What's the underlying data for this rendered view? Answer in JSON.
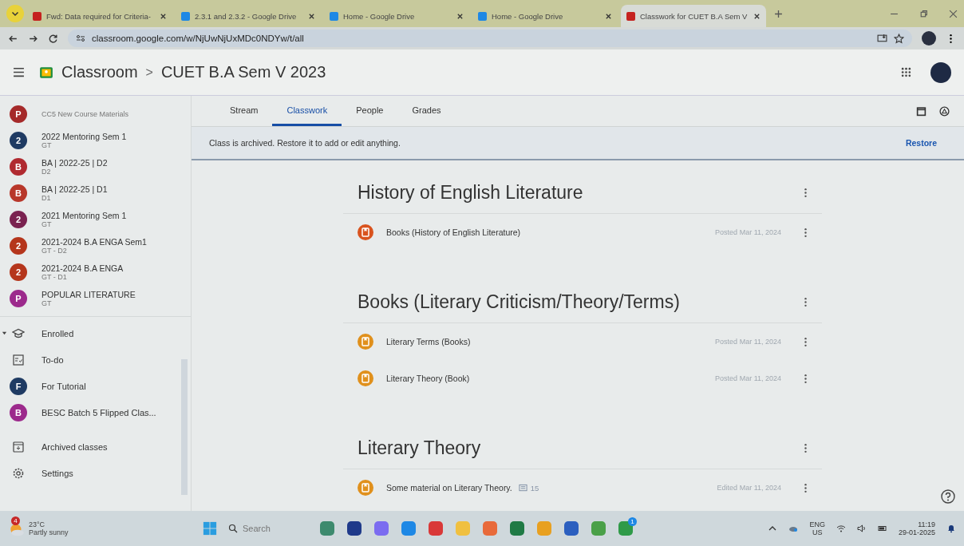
{
  "browser": {
    "tabs": [
      {
        "title": "Fwd: Data required for Criteria-",
        "selected": false
      },
      {
        "title": "2.3.1 and 2.3.2 - Google Drive",
        "selected": false
      },
      {
        "title": "Home - Google Drive",
        "selected": false
      },
      {
        "title": "Home - Google Drive",
        "selected": false
      },
      {
        "title": "Classwork for CUET B.A Sem V",
        "selected": true
      }
    ],
    "address": "classroom.google.com/w/NjUwNjUxMDc0NDYw/t/all"
  },
  "header": {
    "app": "Classroom",
    "separator": ">",
    "class_name": "CUET B.A Sem V 2023"
  },
  "sidebar": {
    "classes": [
      {
        "letter": "P",
        "sub": "CC5 New Course Materials",
        "color": "#a52a2a"
      },
      {
        "letter": "2",
        "name": "2022 Mentoring Sem 1",
        "sub": "GT",
        "color": "#1f3b63"
      },
      {
        "letter": "B",
        "name": "BA | 2022-25 | D2",
        "sub": "D2",
        "color": "#b02a30"
      },
      {
        "letter": "B",
        "name": "BA | 2022-25 | D1",
        "sub": "D1",
        "color": "#b8372a"
      },
      {
        "letter": "2",
        "name": "2021 Mentoring Sem 1",
        "sub": "GT",
        "color": "#7a2250"
      },
      {
        "letter": "2",
        "name": "2021-2024 B.A ENGA Sem1",
        "sub": "GT - D2",
        "color": "#b5361c"
      },
      {
        "letter": "2",
        "name": "2021-2024 B.A ENGA",
        "sub": "GT - D1",
        "color": "#b5361c"
      },
      {
        "letter": "P",
        "name": "POPULAR LITERATURE",
        "sub": "GT",
        "color": "#9c2a8c"
      }
    ],
    "enrolled": {
      "label": "Enrolled",
      "expanded": true
    },
    "enrolled_items": [
      {
        "kind": "todo",
        "label": "To-do"
      },
      {
        "kind": "class",
        "letter": "F",
        "label": "For Tutorial",
        "color": "#1f3b63"
      },
      {
        "kind": "class",
        "letter": "B",
        "label": "BESC Batch 5 Flipped Clas...",
        "color": "#9c2a8c"
      }
    ],
    "bottom_items": [
      {
        "kind": "archive",
        "label": "Archived classes"
      },
      {
        "kind": "settings",
        "label": "Settings"
      }
    ]
  },
  "tabs": [
    {
      "label": "Stream",
      "selected": false
    },
    {
      "label": "Classwork",
      "selected": true
    },
    {
      "label": "People",
      "selected": false
    },
    {
      "label": "Grades",
      "selected": false
    }
  ],
  "banner": {
    "message": "Class is archived. Restore it to add or edit anything.",
    "action": "Restore"
  },
  "topics": [
    {
      "title": "History of English Literature",
      "items": [
        {
          "title": "Books (History of English Literature)",
          "date": "Posted Mar 11, 2024",
          "color": "#d9531e"
        }
      ]
    },
    {
      "title": "Books (Literary Criticism/Theory/Terms)",
      "items": [
        {
          "title": "Literary Terms (Books)",
          "date": "Posted Mar 11, 2024",
          "color": "#e0901c"
        },
        {
          "title": "Literary Theory (Book)",
          "date": "Posted Mar 11, 2024",
          "color": "#e0901c"
        }
      ]
    },
    {
      "title": "Literary Theory",
      "items": [
        {
          "title": "Some material on Literary Theory.",
          "comments": "15",
          "date": "Edited Mar 11, 2024",
          "color": "#e0901c"
        }
      ]
    }
  ],
  "taskbar": {
    "weather": {
      "badge": "4",
      "temp": "23°C",
      "condition": "Partly sunny"
    },
    "search": {
      "placeholder": "Search"
    },
    "apps": [
      {
        "color": "#3d8a6e"
      },
      {
        "color": "#1f3a8a"
      },
      {
        "color": "#7b6cf0"
      },
      {
        "color": "#1e88e5"
      },
      {
        "color": "#d93838"
      },
      {
        "color": "#f0c040"
      },
      {
        "color": "#e86a3a"
      },
      {
        "color": "#1f7a45"
      },
      {
        "color": "#e8a020"
      },
      {
        "color": "#2b5fbf"
      },
      {
        "color": "#4aa048"
      },
      {
        "color": "#2f9a48",
        "badge": "1"
      }
    ],
    "lang": "ENG",
    "region": "US",
    "time": "11:19",
    "date": "29-01-2025"
  }
}
